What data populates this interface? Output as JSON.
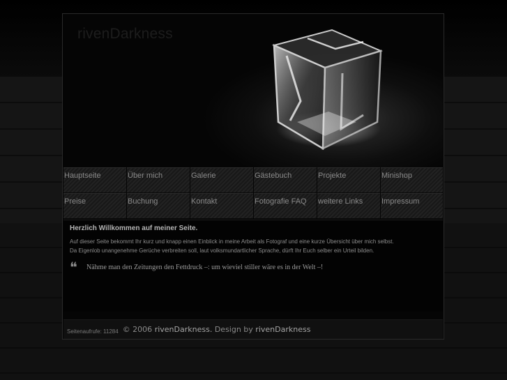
{
  "site": {
    "logo": "rivenDarkness"
  },
  "nav": {
    "row1": [
      "Hauptseite",
      "Über mich",
      "Galerie",
      "Gästebuch",
      "Projekte",
      "Minishop"
    ],
    "row2": [
      "Preise",
      "Buchung",
      "Kontakt",
      "Fotografie FAQ",
      "weitere Links",
      "Impressum"
    ]
  },
  "content": {
    "welcome": "Herzlich Willkommen auf meiner Seite.",
    "line1": "Auf dieser Seite bekommt Ihr kurz und knapp einen Einblick in meine Arbeit als Fotograf und eine kurze Übersicht über mich selbst.",
    "line2": "Da Eigenlob unangenehme Gerüche verbreiten soll, laut volksmundartlicher Sprache, dürft Ihr Euch selber ein Urteil bilden.",
    "quote_mark": "❝",
    "quote": "Nähme man den Zeitungen den Fettdruck –: um wieviel stiller wäre es in der Welt –!"
  },
  "footer": {
    "counter": "Seitenaufrufe: 11284",
    "copy_prefix": "© 2006",
    "copy_name": "rivenDarkness.",
    "design_by": "Design by",
    "designer": "rivenDarkness"
  }
}
